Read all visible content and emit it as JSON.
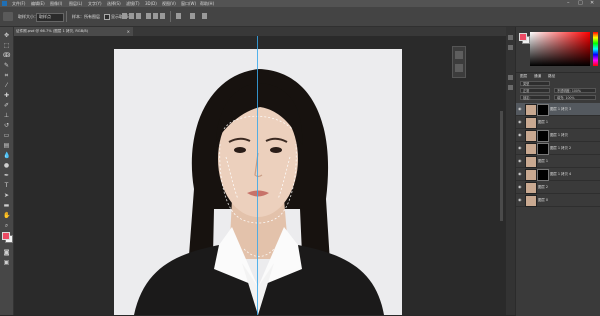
{
  "menubar": {
    "items": [
      "文件(F)",
      "编辑(E)",
      "图像(I)",
      "图层(L)",
      "文字(Y)",
      "选择(S)",
      "滤镜(T)",
      "3D(D)",
      "视图(V)",
      "窗口(W)",
      "帮助(H)"
    ],
    "window_controls": [
      "–",
      "□",
      "✕"
    ]
  },
  "options_bar": {
    "sample_label": "取样大小：",
    "sample_value": "取样点",
    "sample_all_layers": "样本：所有图层",
    "show_ring_label": "显示取样环"
  },
  "document_tab": {
    "title": "证件照.psd @ 66.7% (图层 1 拷贝, RGB/8)",
    "close": "×"
  },
  "colors": {
    "foreground": "#ed4a64",
    "background": "#f4f4f4",
    "guide": "#3aa8ea"
  },
  "layers_panel": {
    "tabs": [
      "图层",
      "通道",
      "路径"
    ],
    "kind_filter": "类型",
    "blend_mode": "正常",
    "opacity_label": "不透明度: 100%",
    "lock_label": "锁定:",
    "fill_label": "填充: 100%",
    "layers": [
      {
        "name": "图层 1 拷贝 3",
        "selected": true,
        "has_mask": true
      },
      {
        "name": "图层 1",
        "selected": false,
        "has_mask": false
      },
      {
        "name": "图层 1 拷贝",
        "selected": false,
        "has_mask": true
      },
      {
        "name": "图层 1 拷贝 2",
        "selected": false,
        "has_mask": true
      },
      {
        "name": "图层 1",
        "selected": false,
        "has_mask": false
      },
      {
        "name": "图层 1 拷贝 4",
        "selected": false,
        "has_mask": true
      },
      {
        "name": "图层 2",
        "selected": false,
        "has_mask": false
      },
      {
        "name": "图层 0",
        "selected": false,
        "has_mask": false
      }
    ]
  }
}
